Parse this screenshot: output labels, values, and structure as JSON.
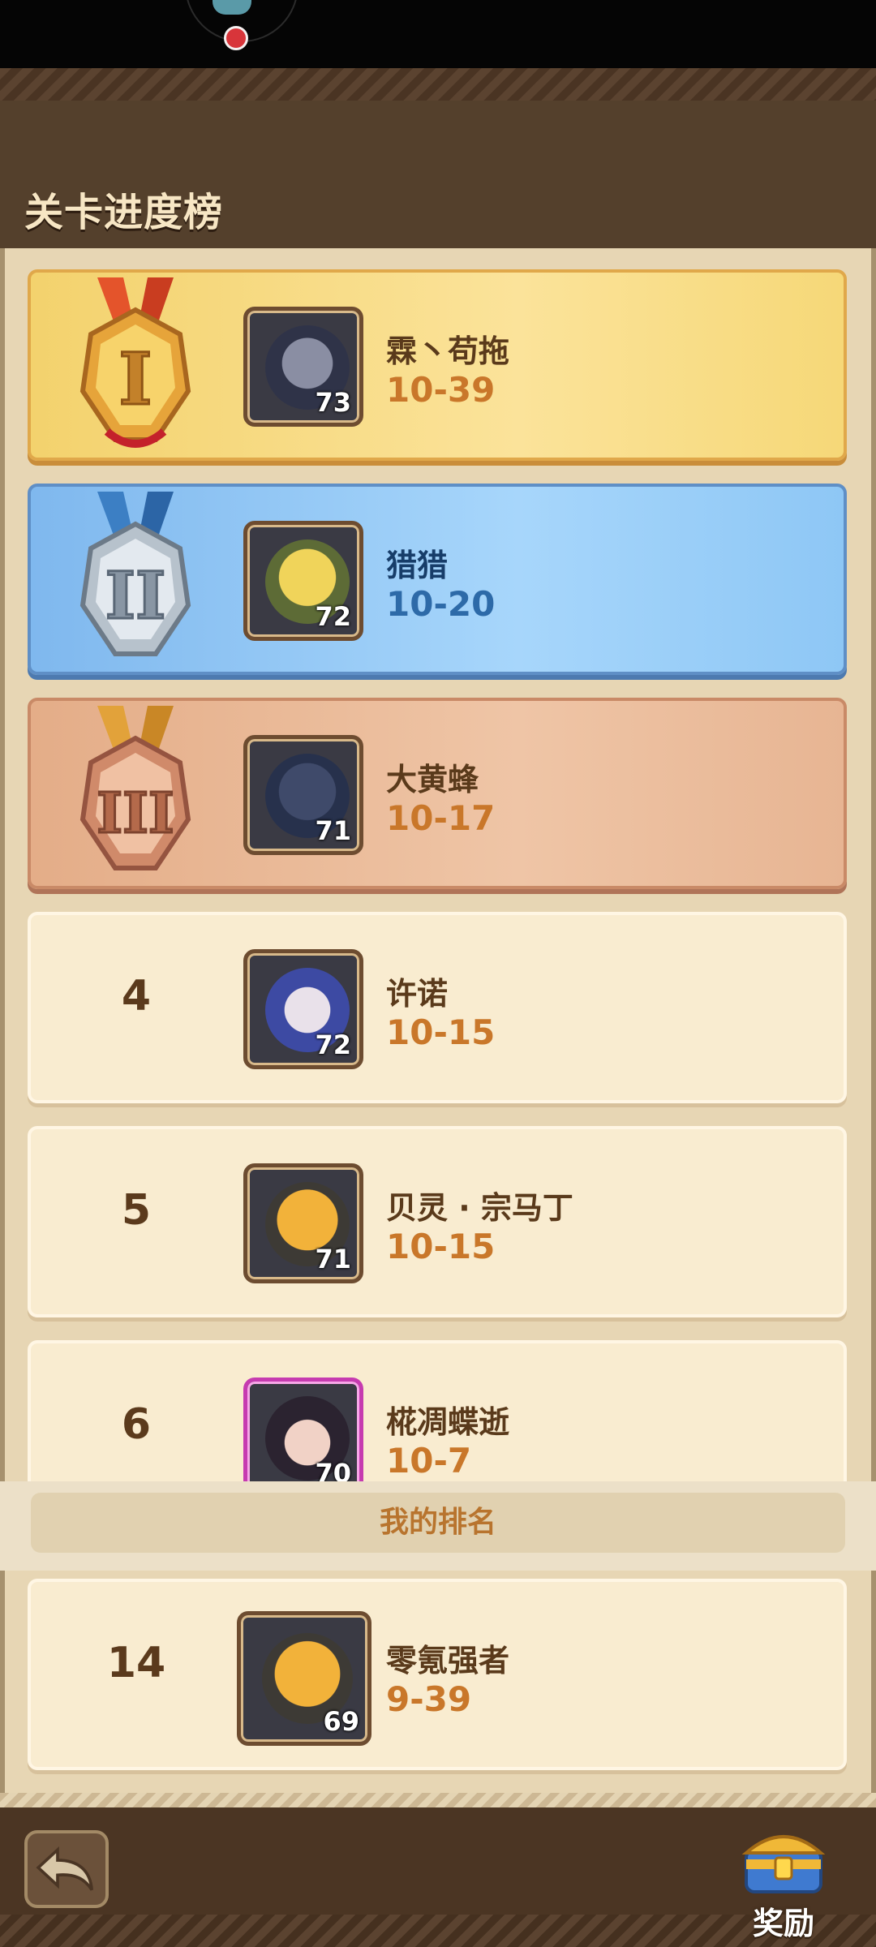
{
  "header": {
    "title": "关卡进度榜"
  },
  "leaderboard": [
    {
      "rank": "1",
      "name": "霖丶苟拖",
      "level": "73",
      "score": "10-39",
      "tier": "gold"
    },
    {
      "rank": "2",
      "name": "猎猎",
      "level": "72",
      "score": "10-20",
      "tier": "silver"
    },
    {
      "rank": "3",
      "name": "大黄蜂",
      "level": "71",
      "score": "10-17",
      "tier": "bronze"
    },
    {
      "rank": "4",
      "name": "许诺",
      "level": "72",
      "score": "10-15",
      "tier": "plain"
    },
    {
      "rank": "5",
      "name": "贝灵 · 宗马丁",
      "level": "71",
      "score": "10-15",
      "tier": "plain"
    },
    {
      "rank": "6",
      "name": "椛凋蝶逝",
      "level": "70",
      "score": "10-7",
      "tier": "plain"
    }
  ],
  "my_rank": {
    "label": "我的排名",
    "rank": "14",
    "name": "零氪强者",
    "level": "69",
    "score": "9-39"
  },
  "footer": {
    "reward_label": "奖励"
  },
  "icons": [
    "back-arrow-icon",
    "treasure-chest-icon",
    "medal-rank-1-icon",
    "medal-rank-2-icon",
    "medal-rank-3-icon"
  ]
}
